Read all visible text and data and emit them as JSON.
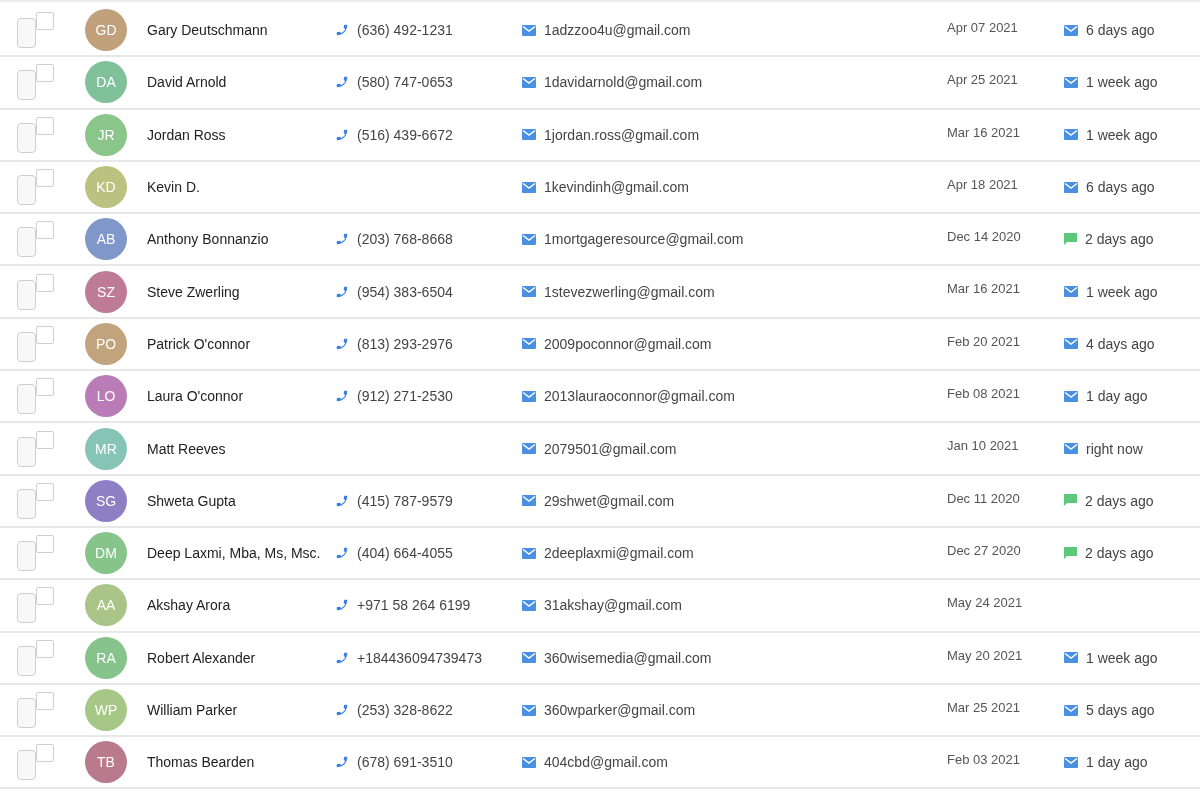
{
  "contacts": [
    {
      "checked": false,
      "initials": "GD",
      "color": "#c1a07c",
      "name": "Gary Deutschmann",
      "phone": "(636) 492-1231",
      "email": "1adzzoo4u@gmail.com",
      "date": "Apr 07 2021",
      "activity": {
        "kind": "email",
        "text": "6 days ago"
      }
    },
    {
      "checked": false,
      "initials": "DA",
      "color": "#80c19a",
      "name": "David Arnold",
      "phone": "(580) 747-0653",
      "email": "1davidarnold@gmail.com",
      "date": "Apr 25 2021",
      "activity": {
        "kind": "email",
        "text": "1 week ago"
      }
    },
    {
      "checked": false,
      "initials": "JR",
      "color": "#8ac68a",
      "name": "Jordan Ross",
      "phone": "(516) 439-6672",
      "email": "1jordan.ross@gmail.com",
      "date": "Mar 16 2021",
      "activity": {
        "kind": "email",
        "text": "1 week ago"
      }
    },
    {
      "checked": false,
      "initials": "KD",
      "color": "#b9c27e",
      "name": "Kevin D.",
      "email": "1kevindinh@gmail.com",
      "date": "Apr 18 2021",
      "activity": {
        "kind": "email",
        "text": "6 days ago"
      }
    },
    {
      "checked": false,
      "initials": "AB",
      "color": "#7f97c9",
      "name": "Anthony Bonnanzio",
      "phone": "(203) 768-8668",
      "email": "1mortgageresource@gmail.com",
      "date": "Dec 14 2020",
      "activity": {
        "kind": "sms",
        "text": "2 days ago"
      }
    },
    {
      "checked": false,
      "initials": "SZ",
      "color": "#bd7b95",
      "name": "Steve Zwerling",
      "phone": "(954) 383-6504",
      "email": "1stevezwerling@gmail.com",
      "date": "Mar 16 2021",
      "activity": {
        "kind": "email",
        "text": "1 week ago"
      }
    },
    {
      "checked": false,
      "initials": "PO",
      "color": "#c2a47c",
      "name": "Patrick O'connor",
      "phone": "(813) 293-2976",
      "email": "2009poconnor@gmail.com",
      "date": "Feb 20 2021",
      "activity": {
        "kind": "email",
        "text": "4 days ago"
      }
    },
    {
      "checked": false,
      "initials": "LO",
      "color": "#b97cb7",
      "name": "Laura O'connor",
      "phone": "(912) 271-2530",
      "email": "2013lauraoconnor@gmail.com",
      "date": "Feb 08 2021",
      "activity": {
        "kind": "email",
        "text": "1 day ago"
      }
    },
    {
      "checked": false,
      "initials": "MR",
      "color": "#86c4b6",
      "name": "Matt Reeves",
      "email": "2079501@gmail.com",
      "date": "Jan 10 2021",
      "activity": {
        "kind": "email",
        "text": "right now"
      }
    },
    {
      "checked": false,
      "initials": "SG",
      "color": "#8c7fc4",
      "name": "Shweta Gupta",
      "phone": "(415) 787-9579",
      "email": "29shwet@gmail.com",
      "date": "Dec 11 2020",
      "activity": {
        "kind": "sms",
        "text": "2 days ago"
      }
    },
    {
      "checked": false,
      "initials": "DM",
      "color": "#86c48a",
      "name": "Deep Laxmi, Mba, Ms, Msc.",
      "phone": "(404) 664-4055",
      "email": "2deeplaxmi@gmail.com",
      "date": "Dec 27 2020",
      "activity": {
        "kind": "sms",
        "text": "2 days ago"
      }
    },
    {
      "checked": false,
      "initials": "AA",
      "color": "#a9c486",
      "name": "Akshay Arora",
      "phone": "+971 58 264 6199",
      "email": "31akshay@gmail.com",
      "date": "May 24 2021"
    },
    {
      "checked": false,
      "initials": "RA",
      "color": "#86c48c",
      "name": "Robert Alexander",
      "phone": "+184436094739473",
      "email": "360wisemedia@gmail.com",
      "date": "May 20 2021",
      "activity": {
        "kind": "email",
        "text": "1 week ago"
      }
    },
    {
      "checked": false,
      "initials": "WP",
      "color": "#a6c786",
      "name": "William Parker",
      "phone": "(253) 328-8622",
      "email": "360wparker@gmail.com",
      "date": "Mar 25 2021",
      "activity": {
        "kind": "email",
        "text": "5 days ago"
      }
    },
    {
      "checked": false,
      "initials": "TB",
      "color": "#b87a8c",
      "name": "Thomas Bearden",
      "phone": "(678) 691-3510",
      "email": "404cbd@gmail.com",
      "date": "Feb 03 2021",
      "activity": {
        "kind": "email",
        "text": "1 day ago"
      }
    }
  ]
}
